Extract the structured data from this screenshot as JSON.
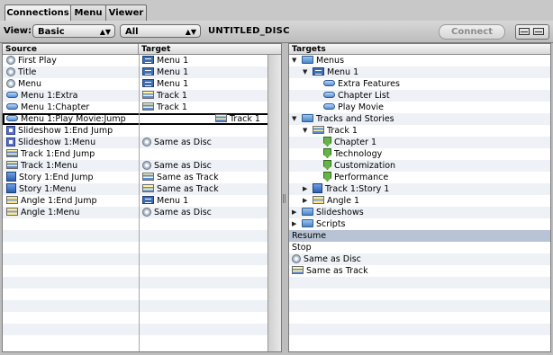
{
  "tabs": [
    {
      "label": "Connections",
      "active": true
    },
    {
      "label": "Menu",
      "active": false
    },
    {
      "label": "Viewer",
      "active": false
    }
  ],
  "toolbar": {
    "view_label": "View:",
    "view_value": "Basic",
    "filter_value": "All",
    "disc_name": "UNTITLED_DISC",
    "connect_label": "Connect"
  },
  "left": {
    "source_header": "Source",
    "target_header": "Target",
    "rows": [
      {
        "source": "First Play",
        "source_icon": "disc-icon",
        "target": "Menu 1",
        "target_icon": "menu-icon"
      },
      {
        "source": "Title",
        "source_icon": "disc-icon",
        "target": "Menu 1",
        "target_icon": "menu-icon"
      },
      {
        "source": "Menu",
        "source_icon": "disc-icon",
        "target": "Menu 1",
        "target_icon": "menu-icon"
      },
      {
        "source": "Menu 1:Extra",
        "source_icon": "button-icon",
        "target": "Track 1",
        "target_icon": "track-icon"
      },
      {
        "source": "Menu 1:Chapter",
        "source_icon": "button-icon",
        "target": "Track 1",
        "target_icon": "track-icon"
      },
      {
        "source": "Menu 1:Play Movie:Jump",
        "source_icon": "button-icon",
        "target": "Track 1",
        "target_icon": "track-icon",
        "selected": true
      },
      {
        "source": "Slideshow 1:End Jump",
        "source_icon": "slideshow-icon",
        "target": "",
        "target_icon": ""
      },
      {
        "source": "Slideshow 1:Menu",
        "source_icon": "slideshow-icon",
        "target": "Same as Disc",
        "target_icon": "disc-icon"
      },
      {
        "source": "Track 1:End Jump",
        "source_icon": "track-icon",
        "target": "",
        "target_icon": ""
      },
      {
        "source": "Track 1:Menu",
        "source_icon": "track-icon",
        "target": "Same as Disc",
        "target_icon": "disc-icon"
      },
      {
        "source": "Story 1:End Jump",
        "source_icon": "story-icon",
        "target": "Same as Track",
        "target_icon": "track-icon"
      },
      {
        "source": "Story 1:Menu",
        "source_icon": "story-icon",
        "target": "Same as Track",
        "target_icon": "track-icon"
      },
      {
        "source": "Angle 1:End Jump",
        "source_icon": "angle-icon",
        "target": "Menu 1",
        "target_icon": "menu-icon"
      },
      {
        "source": "Angle 1:Menu",
        "source_icon": "angle-icon",
        "target": "Same as Disc",
        "target_icon": "disc-icon"
      }
    ]
  },
  "right": {
    "header": "Targets",
    "items": [
      {
        "label": "Menus",
        "icon": "folder-icon",
        "level": 0,
        "disclosure": "open"
      },
      {
        "label": "Menu 1",
        "icon": "menu-icon",
        "level": 1,
        "disclosure": "open"
      },
      {
        "label": "Extra Features",
        "icon": "button-icon",
        "level": 2,
        "disclosure": ""
      },
      {
        "label": "Chapter List",
        "icon": "button-icon",
        "level": 2,
        "disclosure": ""
      },
      {
        "label": "Play Movie",
        "icon": "button-icon",
        "level": 2,
        "disclosure": ""
      },
      {
        "label": "Tracks and Stories",
        "icon": "folder-icon",
        "level": 0,
        "disclosure": "open"
      },
      {
        "label": "Track 1",
        "icon": "track-icon",
        "level": 1,
        "disclosure": "open"
      },
      {
        "label": "Chapter 1",
        "icon": "chapter-marker-icon",
        "level": 2,
        "disclosure": ""
      },
      {
        "label": "Technology",
        "icon": "chapter-marker-icon",
        "level": 2,
        "disclosure": ""
      },
      {
        "label": "Customization",
        "icon": "chapter-marker-icon",
        "level": 2,
        "disclosure": ""
      },
      {
        "label": "Performance",
        "icon": "chapter-marker-icon",
        "level": 2,
        "disclosure": ""
      },
      {
        "label": "Track 1:Story 1",
        "icon": "story-icon",
        "level": 1,
        "disclosure": "closed"
      },
      {
        "label": "Angle 1",
        "icon": "angle-icon",
        "level": 1,
        "disclosure": "closed"
      },
      {
        "label": "Slideshows",
        "icon": "folder-icon",
        "level": 0,
        "disclosure": "closed"
      },
      {
        "label": "Scripts",
        "icon": "folder-icon",
        "level": 0,
        "disclosure": "closed"
      },
      {
        "label": "Resume",
        "icon": "",
        "level": -1,
        "disclosure": "",
        "highlight": true
      },
      {
        "label": "Stop",
        "icon": "",
        "level": -1,
        "disclosure": ""
      },
      {
        "label": "Same as Disc",
        "icon": "disc-icon",
        "level": -1,
        "disclosure": ""
      },
      {
        "label": "Same as Track",
        "icon": "track-icon",
        "level": -1,
        "disclosure": ""
      }
    ]
  }
}
